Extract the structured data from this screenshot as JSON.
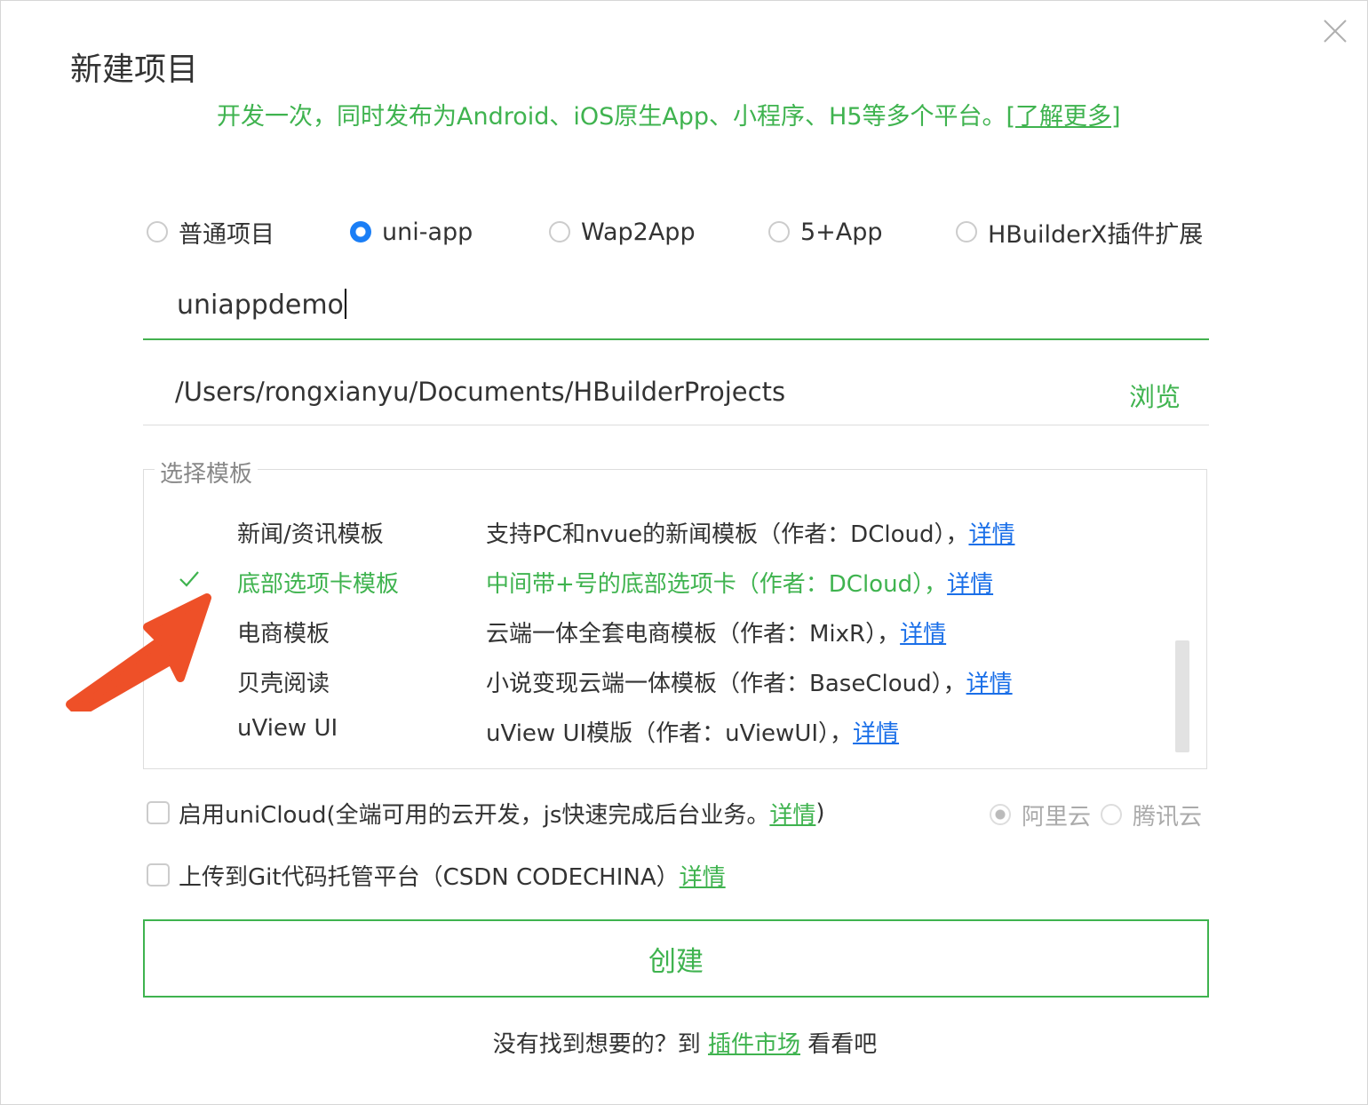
{
  "dialog": {
    "title": "新建项目",
    "subtitle": "开发一次，同时发布为Android、iOS原生App、小程序、H5等多个平台。",
    "learn_more": "[了解更多]"
  },
  "project_types": [
    {
      "label": "普通项目",
      "selected": false
    },
    {
      "label": "uni-app",
      "selected": true
    },
    {
      "label": "Wap2App",
      "selected": false
    },
    {
      "label": "5+App",
      "selected": false
    },
    {
      "label": "HBuilderX插件扩展",
      "selected": false
    }
  ],
  "project_name": {
    "value": "uniappdemo"
  },
  "project_path": {
    "value": "/Users/rongxianyu/Documents/HBuilderProjects",
    "browse_label": "浏览"
  },
  "templates": {
    "legend": "选择模板",
    "link_label": "详情",
    "items": [
      {
        "name": "新闻/资讯模板",
        "desc": "支持PC和nvue的新闻模板（作者：DCloud），",
        "selected": false
      },
      {
        "name": "底部选项卡模板",
        "desc": "中间带+号的底部选项卡（作者：DCloud），",
        "selected": true
      },
      {
        "name": "电商模板",
        "desc": "云端一体全套电商模板（作者：MixR），",
        "selected": false
      },
      {
        "name": "贝壳阅读",
        "desc": "小说变现云端一体模板（作者：BaseCloud），",
        "selected": false
      },
      {
        "name": "uView UI",
        "desc": "uView UI模版（作者：uViewUI），",
        "selected": false
      }
    ]
  },
  "unicloud": {
    "label": "启用uniCloud(全端可用的云开发，js快速完成后台业务。",
    "link": "详情",
    "suffix": ")",
    "checked": false,
    "providers": [
      {
        "label": "阿里云",
        "selected": true
      },
      {
        "label": "腾讯云",
        "selected": false
      }
    ]
  },
  "git": {
    "label": "上传到Git代码托管平台（CSDN CODECHINA）",
    "link": "详情",
    "checked": false
  },
  "create_button": "创建",
  "footer": {
    "prefix": "没有找到想要的？到 ",
    "link": "插件市场",
    "suffix": " 看看吧"
  },
  "colors": {
    "accent_green": "#3fb34f",
    "link_blue": "#1a6fe8",
    "radio_blue": "#1a7ef6",
    "arrow_orange": "#ee5028"
  }
}
